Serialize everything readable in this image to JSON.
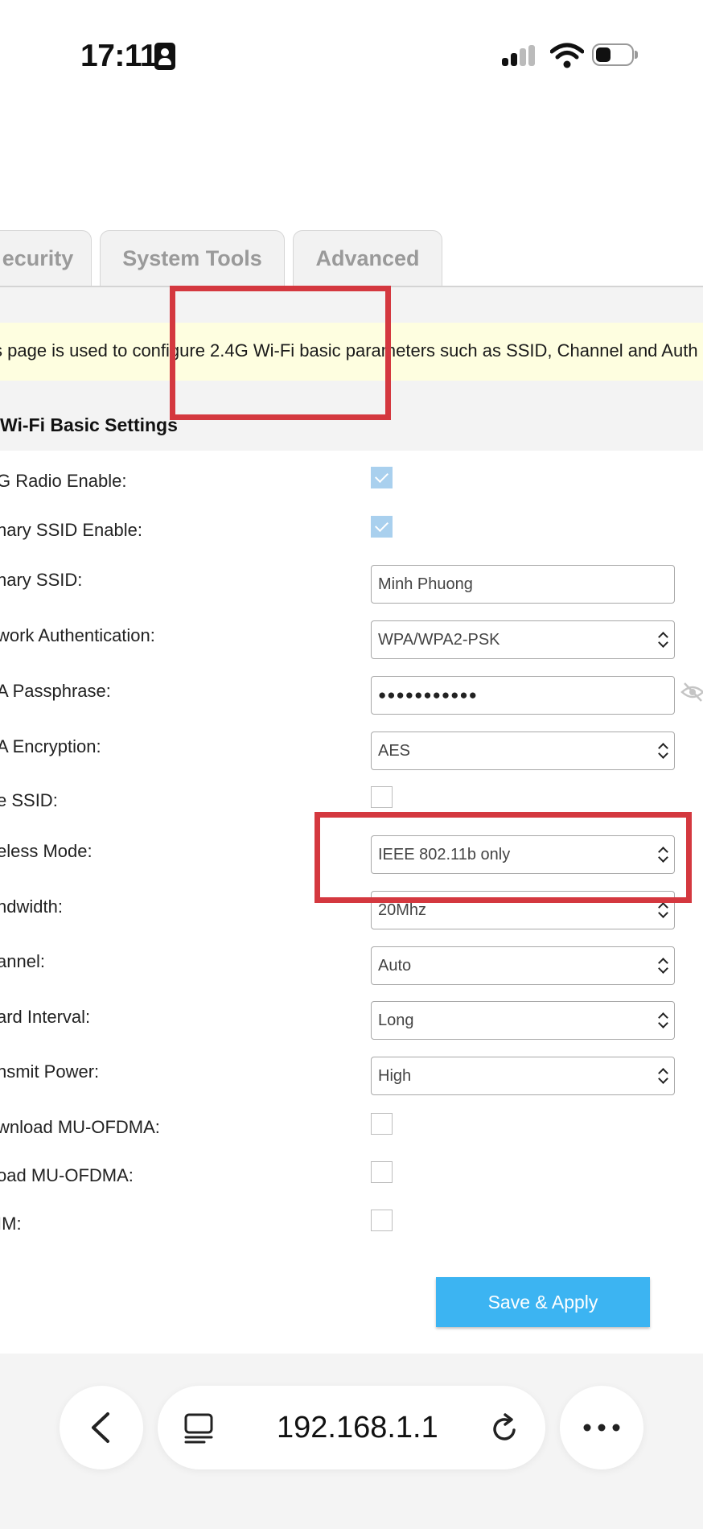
{
  "status_bar": {
    "time": "17:11"
  },
  "tabs": [
    {
      "label": "ecurity"
    },
    {
      "label": "System Tools"
    },
    {
      "label": "Advanced"
    }
  ],
  "info_text": "s page is used to configure 2.4G Wi-Fi basic parameters such as SSID, Channel and Auth",
  "section_title": "Wi-Fi Basic Settings",
  "form": {
    "radio_enable": {
      "label": "G Radio Enable:",
      "checked": true
    },
    "primary_ssid_enable": {
      "label": "nary SSID Enable:",
      "checked": true
    },
    "primary_ssid": {
      "label": "nary SSID:",
      "value": "Minh Phuong"
    },
    "network_auth": {
      "label": "work Authentication:",
      "value": "WPA/WPA2-PSK"
    },
    "passphrase": {
      "label": "A Passphrase:",
      "value": "●●●●●●●●●●●"
    },
    "encryption": {
      "label": "A Encryption:",
      "value": "AES"
    },
    "hide_ssid": {
      "label": "e SSID:",
      "checked": false
    },
    "wireless_mode": {
      "label": "eless Mode:",
      "value": "IEEE 802.11b only"
    },
    "bandwidth": {
      "label": "ndwidth:",
      "value": "20Mhz"
    },
    "channel": {
      "label": "annel:",
      "value": "Auto"
    },
    "guard_interval": {
      "label": "ard Interval:",
      "value": "Long"
    },
    "transmit_power": {
      "label": "nsmit Power:",
      "value": "High"
    },
    "dl_mu_ofdma": {
      "label": "wnload MU-OFDMA:",
      "checked": false
    },
    "ul_mu_ofdma": {
      "label": "oad MU-OFDMA:",
      "checked": false
    },
    "wmm": {
      "label": "IM:",
      "checked": false
    }
  },
  "save_button": "Save & Apply",
  "browser": {
    "url": "192.168.1.1"
  },
  "colors": {
    "accent": "#3cb4f2",
    "highlight": "#d4383f",
    "info_bg": "#fefee0"
  }
}
